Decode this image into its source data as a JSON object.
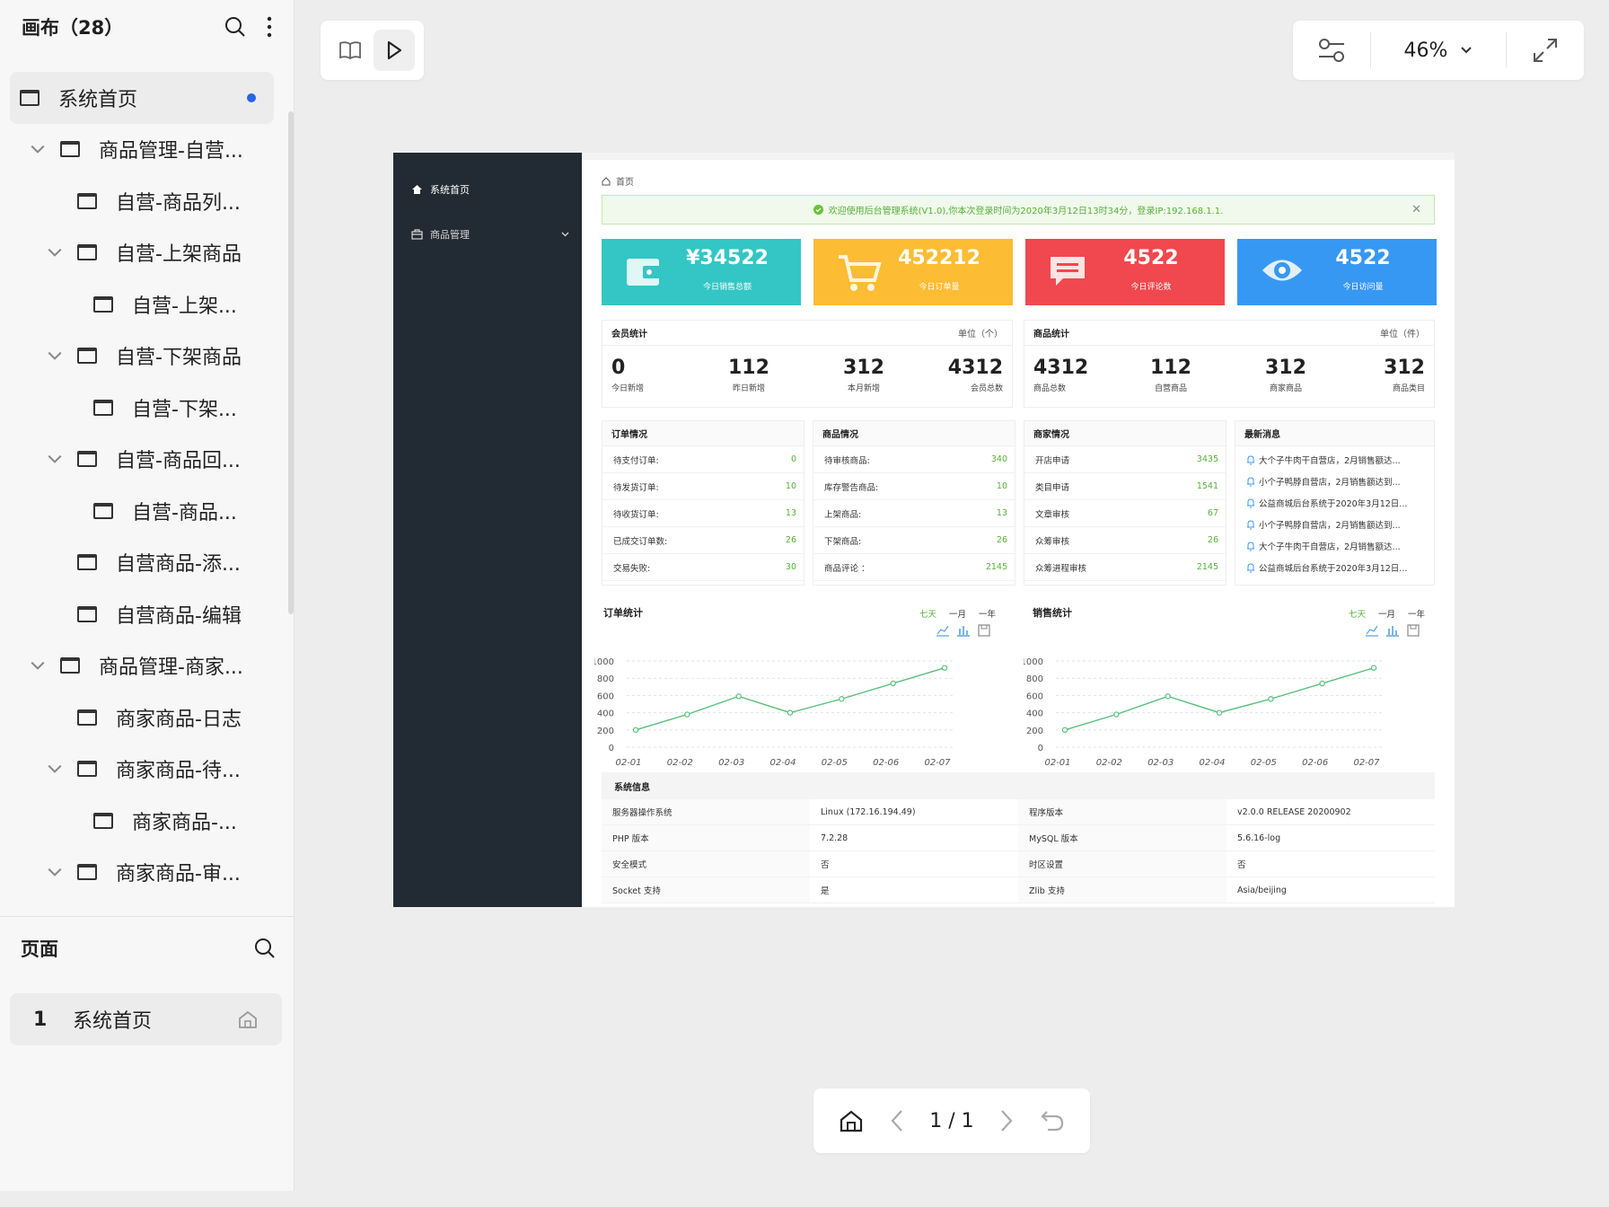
{
  "sidebar": {
    "title": "画布（28）",
    "tree": [
      {
        "label": "系统首页",
        "level": 0,
        "chevron": false,
        "active": true
      },
      {
        "label": "商品管理-自营...",
        "level": 0,
        "chevron": true
      },
      {
        "label": "自营-商品列...",
        "level": 1,
        "chevron": false
      },
      {
        "label": "自营-上架商品",
        "level": 1,
        "chevron": true
      },
      {
        "label": "自营-上架...",
        "level": 2,
        "chevron": false
      },
      {
        "label": "自营-下架商品",
        "level": 1,
        "chevron": true
      },
      {
        "label": "自营-下架...",
        "level": 2,
        "chevron": false
      },
      {
        "label": "自营-商品回...",
        "level": 1,
        "chevron": true
      },
      {
        "label": "自营-商品...",
        "level": 2,
        "chevron": false
      },
      {
        "label": "自营商品-添...",
        "level": 1,
        "chevron": false
      },
      {
        "label": "自营商品-编辑",
        "level": 1,
        "chevron": false
      },
      {
        "label": "商品管理-商家...",
        "level": 0,
        "chevron": true
      },
      {
        "label": "商家商品-日志",
        "level": 1,
        "chevron": false
      },
      {
        "label": "商家商品-待...",
        "level": 1,
        "chevron": true
      },
      {
        "label": "商家商品-...",
        "level": 2,
        "chevron": false
      },
      {
        "label": "商家商品-审...",
        "level": 1,
        "chevron": true
      }
    ],
    "pages_title": "页面",
    "page_item": {
      "num": "1",
      "label": "系统首页"
    }
  },
  "toolbar": {
    "zoom": "46%"
  },
  "pager": {
    "text": "1 / 1"
  },
  "proto": {
    "nav": {
      "home": "系统首页",
      "goods": "商品管理"
    },
    "breadcrumb": "首页",
    "alert": "欢迎使用后台管理系统(V1.0),你本次登录时间为2020年3月12日13时34分，登录IP:192.168.1.1.",
    "stats": [
      {
        "value": "¥34522",
        "label": "今日销售总额",
        "color": "#33c6c4"
      },
      {
        "value": "452212",
        "label": "今日订单量",
        "color": "#fcbc34"
      },
      {
        "value": "4522",
        "label": "今日评论数",
        "color": "#f0484e"
      },
      {
        "value": "4522",
        "label": "今日访问量",
        "color": "#3798f3"
      }
    ],
    "member": {
      "title": "会员统计",
      "unit": "单位（个）",
      "items": [
        {
          "n": "0",
          "l": "今日新增"
        },
        {
          "n": "112",
          "l": "昨日新增"
        },
        {
          "n": "312",
          "l": "本月新增"
        },
        {
          "n": "4312",
          "l": "会员总数"
        }
      ]
    },
    "goods_stat": {
      "title": "商品统计",
      "unit": "单位（件）",
      "items": [
        {
          "n": "4312",
          "l": "商品总数"
        },
        {
          "n": "112",
          "l": "自营商品"
        },
        {
          "n": "312",
          "l": "商家商品"
        },
        {
          "n": "312",
          "l": "商品类目"
        }
      ]
    },
    "orders": {
      "title": "订单情况",
      "rows": [
        [
          "待支付订单:",
          "0"
        ],
        [
          "待发货订单:",
          "10"
        ],
        [
          "待收货订单:",
          "13"
        ],
        [
          "已成交订单数:",
          "26"
        ],
        [
          "交易失败:",
          "30"
        ]
      ]
    },
    "goods": {
      "title": "商品情况",
      "rows": [
        [
          "待审核商品:",
          "340"
        ],
        [
          "库存警告商品:",
          "10"
        ],
        [
          "上架商品:",
          "13"
        ],
        [
          "下架商品:",
          "26"
        ],
        [
          "商品评论  ：",
          "2145"
        ]
      ]
    },
    "merchants": {
      "title": "商家情况",
      "rows": [
        [
          "开店申请",
          "3435"
        ],
        [
          "类目申请",
          "1541"
        ],
        [
          "文章审核",
          "67"
        ],
        [
          "众筹审核",
          "26"
        ],
        [
          "众筹进程审核",
          "2145"
        ]
      ]
    },
    "news": {
      "title": "最新消息",
      "items": [
        "大个子牛肉干自营店，2月销售额达...",
        "小个子鸭脖自营店，2月销售额达到...",
        "公益商城后台系统于2020年3月12日...",
        "小个子鸭脖自营店，2月销售额达到...",
        "大个子牛肉干自营店，2月销售额达...",
        "公益商城后台系统于2020年3月12日..."
      ]
    },
    "chart_titles": [
      "订单统计",
      "销售统计"
    ],
    "periods": [
      "七天",
      "一月",
      "一年"
    ],
    "sysinfo": {
      "title": "系统信息",
      "rows": [
        [
          "服务器操作系统",
          "Linux (172.16.194.49)",
          "程序版本",
          "v2.0.0 RELEASE 20200902"
        ],
        [
          "PHP 版本",
          "7.2.28",
          "MySQL 版本",
          "5.6.16-log"
        ],
        [
          "安全模式",
          "否",
          "时区设置",
          "否"
        ],
        [
          "Socket 支持",
          "是",
          "Zlib 支持",
          "Asia/beijing"
        ]
      ]
    }
  },
  "chart_data": [
    {
      "type": "line",
      "title": "订单统计",
      "x": [
        "02-01",
        "02-02",
        "02-03",
        "02-04",
        "02-05",
        "02-06",
        "02-07"
      ],
      "values": [
        200,
        380,
        590,
        400,
        560,
        740,
        920
      ],
      "ylim": [
        0,
        1000
      ],
      "yticks": [
        0,
        200,
        400,
        600,
        800,
        1000
      ],
      "color": "#57c17b",
      "grid": true
    },
    {
      "type": "line",
      "title": "销售统计",
      "x": [
        "02-01",
        "02-02",
        "02-03",
        "02-04",
        "02-05",
        "02-06",
        "02-07"
      ],
      "values": [
        200,
        380,
        590,
        400,
        560,
        740,
        920
      ],
      "ylim": [
        0,
        1000
      ],
      "yticks": [
        0,
        200,
        400,
        600,
        800,
        1000
      ],
      "color": "#57c17b",
      "grid": true
    }
  ]
}
